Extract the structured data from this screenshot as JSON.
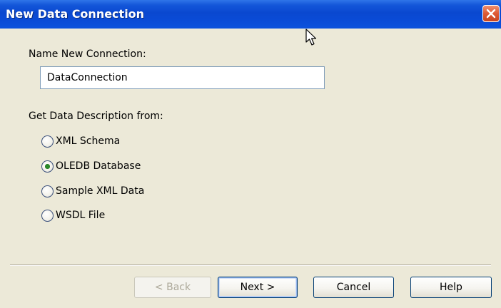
{
  "dialog": {
    "title": "New Data Connection"
  },
  "form": {
    "name_label": "Name New Connection:",
    "name_value": "DataConnection",
    "description_label": "Get Data Description from:",
    "options": [
      {
        "label": "XML Schema",
        "checked": false
      },
      {
        "label": "OLEDB Database",
        "checked": true
      },
      {
        "label": "Sample XML Data",
        "checked": false
      },
      {
        "label": "WSDL File",
        "checked": false
      }
    ]
  },
  "buttons": {
    "back": "< Back",
    "next": "Next >",
    "cancel": "Cancel",
    "help": "Help"
  },
  "icons": {
    "close": "close-icon",
    "cursor": "mouse-pointer-icon"
  },
  "colors": {
    "titlebar": "#0a48d0",
    "close_button": "#de5a35",
    "background": "#ece9d8",
    "selected_radio": "#2a8a2a"
  }
}
